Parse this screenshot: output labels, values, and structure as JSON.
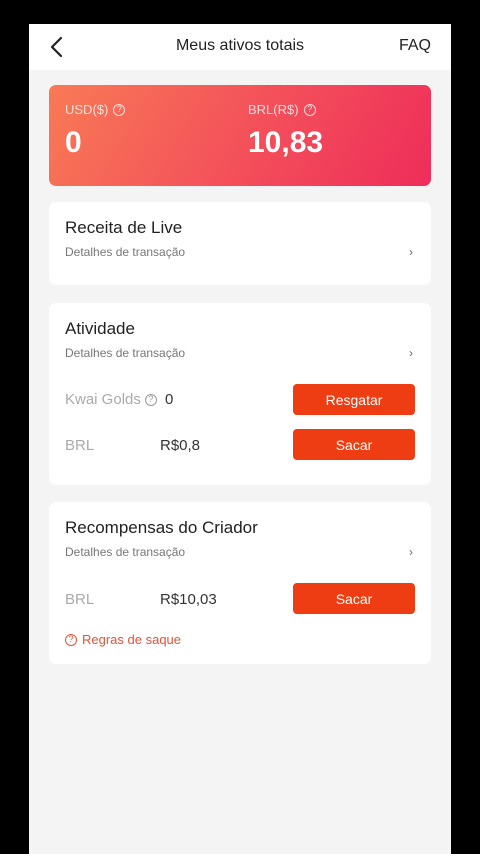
{
  "header": {
    "title": "Meus ativos totais",
    "faq_label": "FAQ"
  },
  "balance": {
    "usd_label": "USD($)",
    "usd_value": "0",
    "brl_label": "BRL(R$)",
    "brl_value": "10,83"
  },
  "cards": {
    "live": {
      "title": "Receita de Live",
      "subtitle": "Detalhes de transação"
    },
    "activity": {
      "title": "Atividade",
      "subtitle": "Detalhes de transação",
      "golds_label": "Kwai Golds",
      "golds_value": "0",
      "redeem_label": "Resgatar",
      "brl_label": "BRL",
      "brl_value": "R$0,8",
      "withdraw_label": "Sacar"
    },
    "creator": {
      "title": "Recompensas do Criador",
      "subtitle": "Detalhes de transação",
      "brl_label": "BRL",
      "brl_value": "R$10,03",
      "withdraw_label": "Sacar",
      "rules_label": "Regras de saque"
    }
  },
  "colors": {
    "accent_button": "#ee3d12",
    "gradient_start": "#f87a55",
    "gradient_end": "#ee2d5a",
    "rules_link": "#e0533a"
  },
  "icons": {
    "back": "chevron-left-icon",
    "help": "question-circle-icon",
    "chevron": "chevron-right-icon"
  }
}
